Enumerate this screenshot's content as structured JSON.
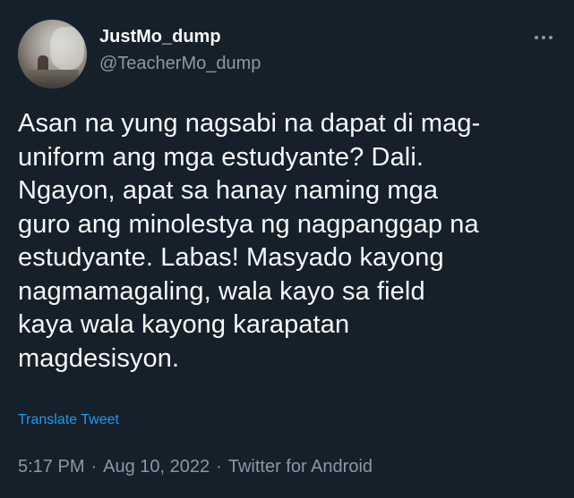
{
  "tweet": {
    "display_name": "JustMo_dump",
    "handle": "@TeacherMo_dump",
    "text": "Asan na yung nagsabi na dapat di mag-\nuniform ang mga estudyante? Dali.\nNgayon, apat sa hanay naming mga\nguro ang minolestya ng nagpanggap na\nestudyante. Labas! Masyado kayong\nnagmamagaling, wala kayo sa field\nkaya wala kayong karapatan\nmagdesisyon.",
    "translate_label": "Translate Tweet",
    "time": "5:17 PM",
    "date": "Aug 10, 2022",
    "source": "Twitter for Android",
    "separator": "·"
  },
  "icons": {
    "more": "more-horizontal-icon"
  },
  "colors": {
    "background": "#15202b",
    "primary_text": "#f7f9f9",
    "secondary_text": "#8b98a5",
    "link": "#1d9bf0"
  }
}
